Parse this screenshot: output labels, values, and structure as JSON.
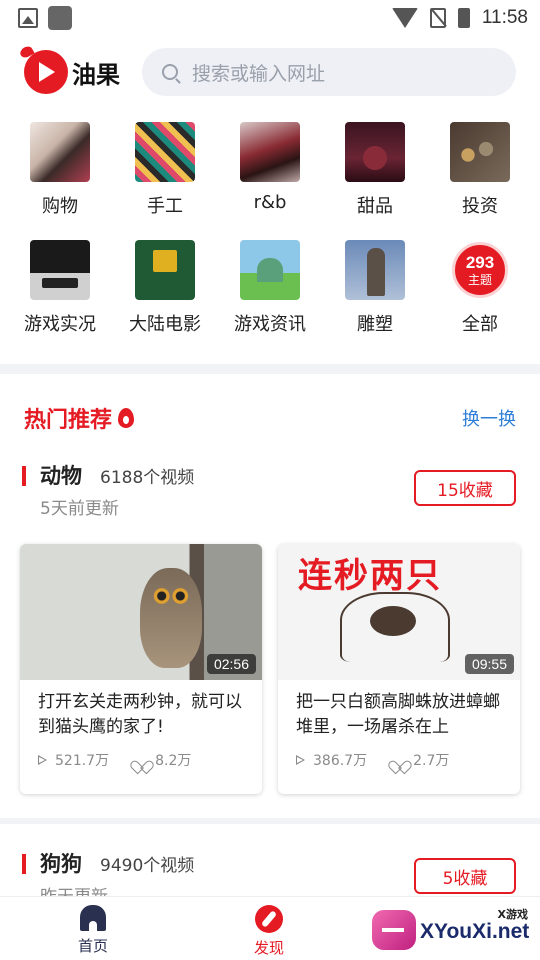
{
  "status_bar": {
    "time": "11:58"
  },
  "header": {
    "app_name": "油果",
    "search_placeholder": "搜索或输入网址"
  },
  "categories": [
    {
      "label": "购物"
    },
    {
      "label": "手工"
    },
    {
      "label": "r&b"
    },
    {
      "label": "甜品"
    },
    {
      "label": "投资"
    },
    {
      "label": "游戏实况"
    },
    {
      "label": "大陆电影"
    },
    {
      "label": "游戏资讯"
    },
    {
      "label": "雕塑"
    },
    {
      "label": "全部",
      "count": "293",
      "count_sub": "主题"
    }
  ],
  "hot": {
    "title": "热门推荐",
    "refresh_label": "换一换"
  },
  "topics": [
    {
      "name": "动物",
      "video_count": "6188个视频",
      "updated": "5天前更新",
      "fav_label": "15收藏",
      "videos": [
        {
          "title": "打开玄关走两秒钟，就可以到猫头鹰的家了!",
          "duration": "02:56",
          "plays": "521.7万",
          "likes": "8.2万"
        },
        {
          "title": "把一只白额高脚蛛放进蟑螂堆里，一场屠杀在上",
          "duration": "09:55",
          "plays": "386.7万",
          "likes": "2.7万",
          "overlay_text": "连秒两只"
        }
      ]
    },
    {
      "name": "狗狗",
      "video_count": "9490个视频",
      "updated": "昨天更新",
      "fav_label": "5收藏"
    }
  ],
  "bottom_nav": {
    "home": "首页",
    "discover": "发现"
  },
  "watermark": {
    "brand": "XYouXi.net",
    "tag": "X游戏"
  },
  "colors": {
    "accent": "#e51b24",
    "link": "#2f7fd8",
    "nav_dark": "#2a3050"
  }
}
